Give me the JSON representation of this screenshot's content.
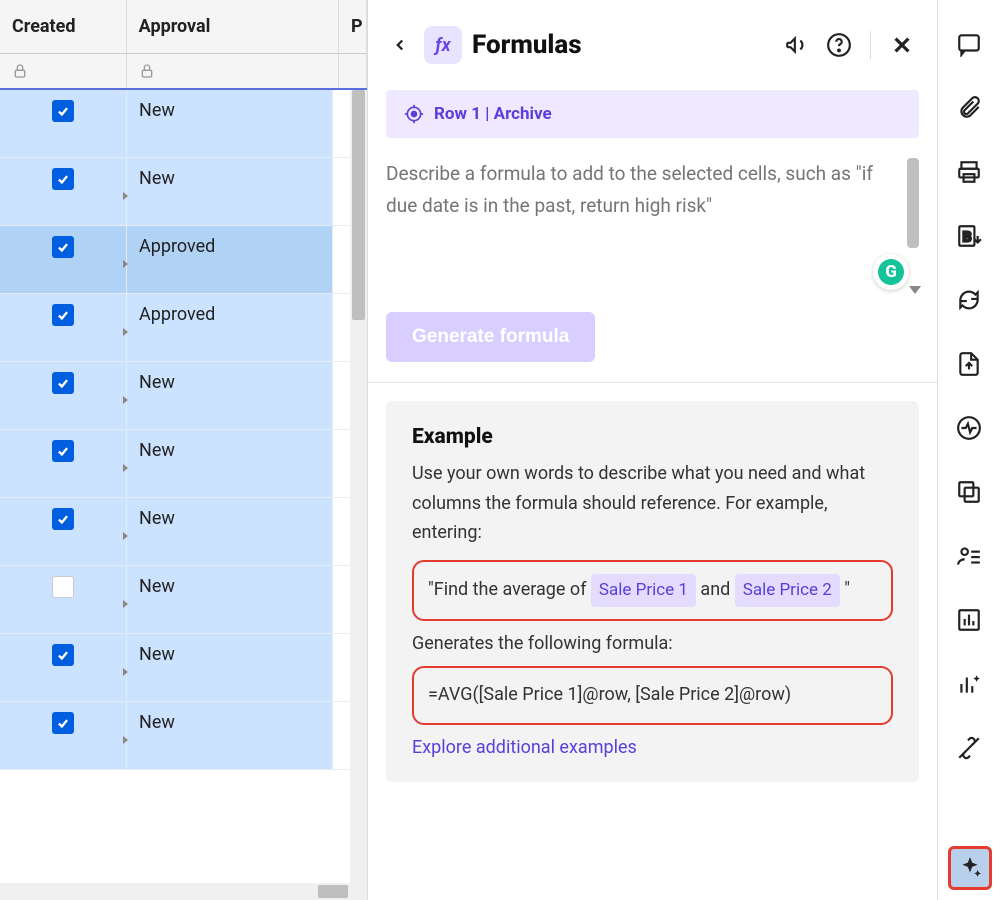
{
  "columns": {
    "created": "Created",
    "approval": "Approval",
    "p": "P"
  },
  "rows": [
    {
      "checked": true,
      "approval": "New",
      "selected": false
    },
    {
      "checked": true,
      "approval": "New",
      "selected": false
    },
    {
      "checked": true,
      "approval": "Approved",
      "selected": true
    },
    {
      "checked": true,
      "approval": "Approved",
      "selected": false
    },
    {
      "checked": true,
      "approval": "New",
      "selected": false
    },
    {
      "checked": true,
      "approval": "New",
      "selected": false
    },
    {
      "checked": true,
      "approval": "New",
      "selected": false
    },
    {
      "checked": false,
      "approval": "New",
      "selected": false
    },
    {
      "checked": true,
      "approval": "New",
      "selected": false
    },
    {
      "checked": true,
      "approval": "New",
      "selected": false
    }
  ],
  "panel": {
    "title": "Formulas",
    "context": "Row 1 | Archive",
    "placeholder": "Describe a formula to add to the selected cells, such as \"if due date is in the past, return high risk\"",
    "generate_label": "Generate formula"
  },
  "example": {
    "heading": "Example",
    "desc": "Use your own words to describe what you need and what columns the formula should reference. For example, entering:",
    "quote_leading": "\"Find the average of ",
    "chip1": "Sale Price 1",
    "quote_middle": " and ",
    "chip2": "Sale Price 2",
    "quote_trailing": " \"",
    "generates": "Generates the following formula:",
    "formula": "=AVG([Sale Price 1]@row, [Sale Price 2]@row)",
    "explore": "Explore additional examples"
  },
  "icons": {
    "announce": "megaphone-icon",
    "help": "help-icon",
    "close": "close-icon",
    "back": "back-icon",
    "target": "target-icon",
    "comments": "comments-icon",
    "attachments": "attachments-icon",
    "print": "print-icon",
    "bold": "bold-download-icon",
    "refresh": "refresh-icon",
    "upload": "file-upload-icon",
    "activity": "activity-icon",
    "copy": "copy-icon",
    "people": "people-icon",
    "chart": "chart-icon",
    "sparkle_chart": "ai-chart-icon",
    "connect": "connect-icon",
    "ai": "ai-sparkle-icon",
    "lock": "lock-icon",
    "grammarly": "grammarly-icon"
  }
}
